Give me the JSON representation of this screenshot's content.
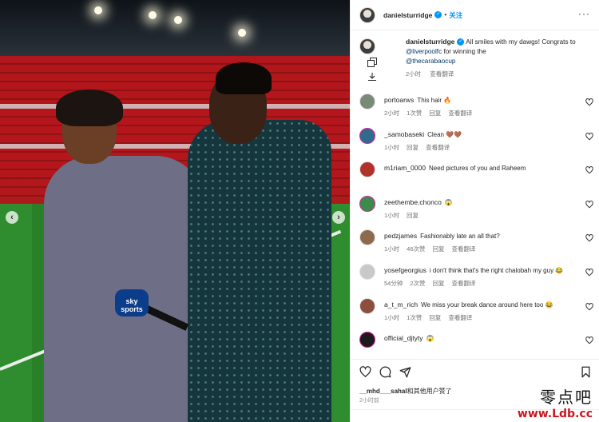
{
  "post": {
    "author": "danielsturridge",
    "follow_label": "关注",
    "caption_text_1": "All smiles with my dawgs! Congrats to ",
    "caption_mention_1": "@liverpoolfc",
    "caption_text_2": " for winning the ",
    "caption_mention_2": "@thecarabaocup",
    "caption_time": "2小时",
    "caption_translate": "查看翻译",
    "mic_brand": "sky sports"
  },
  "comments": [
    {
      "user": "portoarws",
      "text": "This hair 🔥",
      "time": "2小时",
      "likes": "1次赞",
      "reply": "回复",
      "translate": "查看翻译",
      "avatar_color": "#7a8a78",
      "ring": false
    },
    {
      "user": "_samobaseki",
      "text": "Clean 🤎🤎",
      "time": "1小时",
      "likes": "",
      "reply": "回复",
      "translate": "查看翻译",
      "avatar_color": "#2e6b8f",
      "ring": true
    },
    {
      "user": "m1riam_0000",
      "text": "Need pictures of you and Raheem",
      "time": "",
      "likes": "",
      "reply": "",
      "translate": "",
      "avatar_color": "#b0322a",
      "ring": false
    },
    {
      "user": "zeethembe.chonco",
      "text": "😱",
      "time": "1小时",
      "likes": "",
      "reply": "回复",
      "translate": "",
      "avatar_color": "#3b8b4d",
      "ring": true
    },
    {
      "user": "pedzjames",
      "text": "Fashionably late an all that?",
      "time": "1小时",
      "likes": "46次赞",
      "reply": "回复",
      "translate": "查看翻译",
      "avatar_color": "#8e6a4c",
      "ring": false
    },
    {
      "user": "yosefgeorgius",
      "text": "i don't think that's the right chalobah my guy 😂",
      "time": "54分钟",
      "likes": "2次赞",
      "reply": "回复",
      "translate": "查看翻译",
      "avatar_color": "#c9c9c9",
      "ring": false
    },
    {
      "user": "a_t_m_rich",
      "text": "We miss your break dance around here too 😂",
      "time": "1小时",
      "likes": "1次赞",
      "reply": "回复",
      "translate": "查看翻译",
      "avatar_color": "#8c4f3d",
      "ring": false
    },
    {
      "user": "official_djtyty",
      "text": "😱",
      "time": "",
      "likes": "",
      "reply": "",
      "translate": "",
      "avatar_color": "#1b1b1b",
      "ring": true
    }
  ],
  "liked_by": "__mhd___sahal",
  "liked_by_suffix": "和其他用户赞了",
  "post_time": "2小时前",
  "icons": {
    "more": "more-horizontal-icon",
    "heart": "heart-icon",
    "comment": "comment-icon",
    "share": "share-icon",
    "save": "bookmark-icon"
  },
  "watermark": {
    "cn": "零点吧",
    "url": "www.Ldb.cc"
  }
}
